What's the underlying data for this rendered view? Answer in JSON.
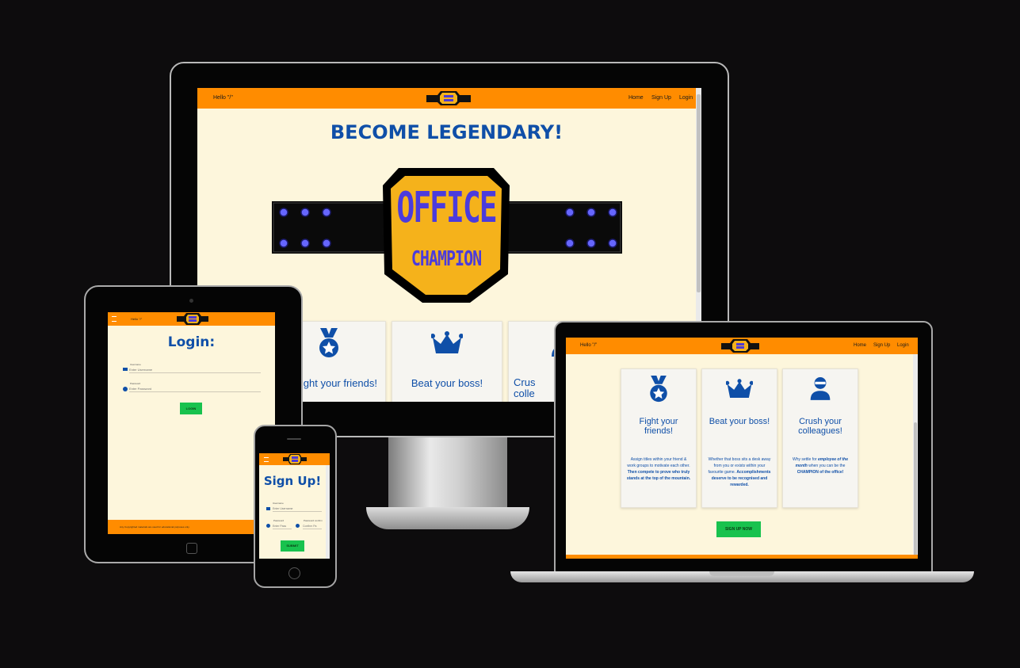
{
  "brand_logo_text": "OFFICE CHAMPION",
  "nav": {
    "greeting": "Hello \"/\"",
    "links": [
      "Home",
      "Sign Up",
      "Login"
    ]
  },
  "hero": {
    "title": "BECOME LEGENDARY!",
    "belt_top": "OFFICE",
    "belt_bottom": "CHAMPION"
  },
  "cards": [
    {
      "title_desktop": "ight your friends!",
      "title": "Fight your friends!",
      "text_plain1": "Assign titles within your friend & work groups to motivate each other. ",
      "text_bold": "Then compete to prove who truly stands at the top of the mountain.",
      "icon": "medal-icon"
    },
    {
      "title": "Beat your boss!",
      "text_plain1": "Whether that boss sits a desk away from you or exists within your favourite game. ",
      "text_bold": "Accomplishments deserve to be recognised and rewarded.",
      "icon": "crown-icon"
    },
    {
      "title_desktop": "Crus colle",
      "title": "Crush your colleagues!",
      "text_plain1": "Why settle for ",
      "text_italic": "employee of the month",
      "text_plain2": " when you can be the ",
      "text_bold": "CHAMPION of the office!",
      "icon": "ninja-icon"
    }
  ],
  "laptop": {
    "cta": "SIGN UP NOW"
  },
  "tablet": {
    "title": "Login:",
    "username_label": "Username",
    "username_placeholder": "Enter Username",
    "password_label": "Password",
    "password_placeholder": "Enter Password",
    "button": "LOGIN",
    "footer": "Any Copyrighted materials are used for educational purposes only."
  },
  "phone": {
    "title": "Sign Up!",
    "username_label": "Username",
    "username_placeholder": "Enter Username",
    "password_label": "Password",
    "password_placeholder": "Enter Pass",
    "confirm_label": "Password confirm",
    "confirm_placeholder": "Confirm Pa",
    "button": "SUBMIT"
  },
  "colors": {
    "background": "#0d0c0d",
    "nav_orange": "#ff8c00",
    "page_cream": "#fdf6dc",
    "accent_blue": "#0f4fa8",
    "button_green": "#18c24e"
  }
}
